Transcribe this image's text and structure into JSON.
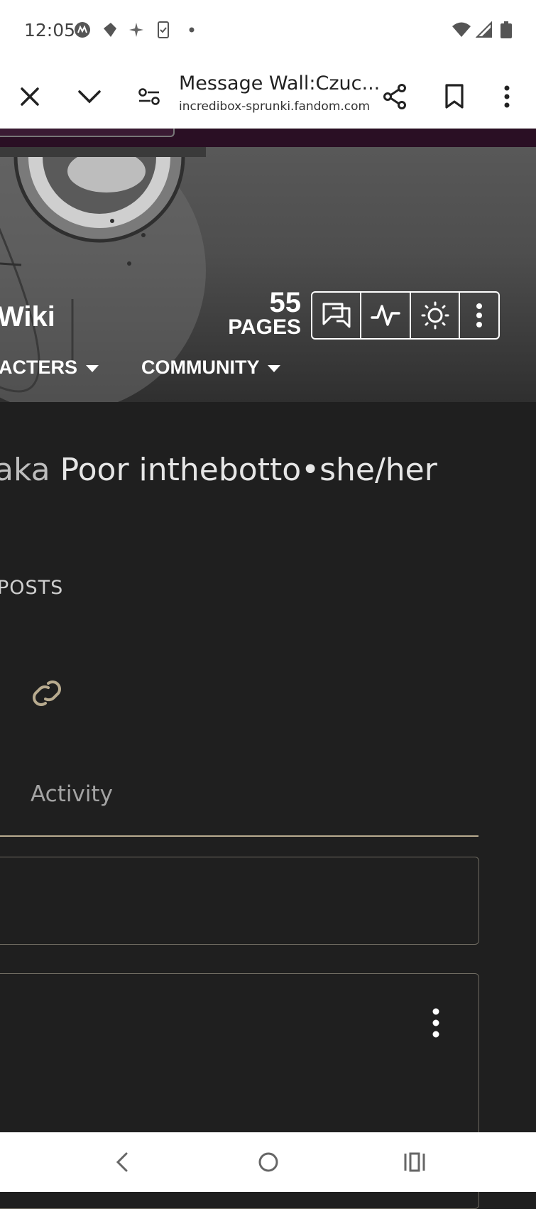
{
  "status_bar": {
    "time": "12:05",
    "left_icons": [
      "motorola-icon",
      "location-off-icon",
      "sparkle-icon",
      "phone-check-icon",
      "dot-icon"
    ],
    "right_icons": [
      "wifi-icon",
      "signal-icon",
      "battery-icon"
    ]
  },
  "tab_bar": {
    "title": "Message Wall:Czuc...",
    "url": "incredibox-sprunki.fandom.com",
    "icons": [
      "close-icon",
      "chevron-down-icon",
      "site-settings-icon",
      "share-icon",
      "bookmark-icon",
      "more-vert-icon"
    ]
  },
  "wiki": {
    "title_fragment": "Wiki",
    "pages_count": "55",
    "pages_label": "PAGES",
    "tools": [
      "discussions-icon",
      "activity-icon",
      "theme-icon",
      "more-vert-icon"
    ],
    "nav": [
      {
        "label": "ACTERS"
      },
      {
        "label": "COMMUNITY"
      }
    ]
  },
  "profile": {
    "name_prefix": "aka",
    "name_rest": "Poor inthebotto•she/her",
    "posts_label": "POSTS",
    "link_icon": "link-icon",
    "activity_label": "Activity"
  },
  "colors": {
    "page_bg": "#1f1f1f",
    "accent": "#b8ab8f",
    "hero_top": "#2a0f24"
  }
}
